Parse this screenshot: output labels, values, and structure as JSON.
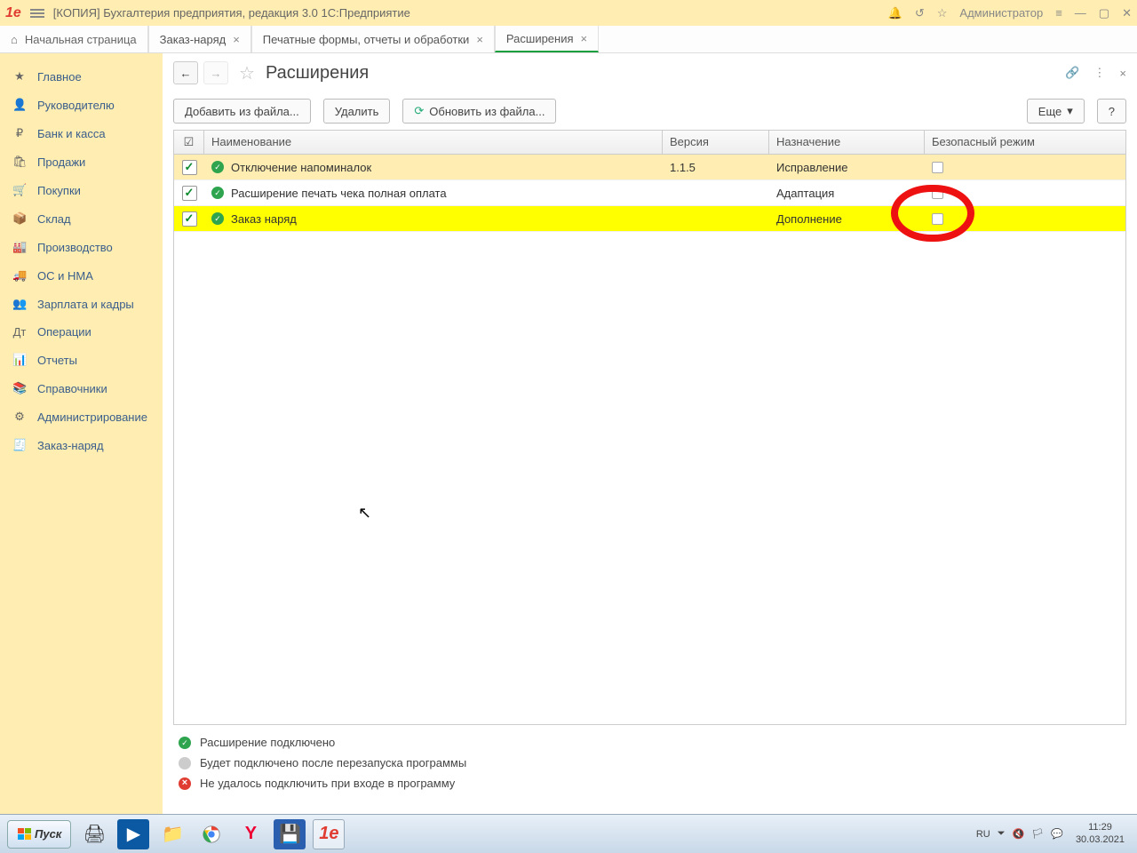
{
  "titlebar": {
    "title": "[КОПИЯ] Бухгалтерия предприятия, редакция 3.0 1С:Предприятие",
    "user": "Администратор"
  },
  "tabs": {
    "home": "Начальная страница",
    "items": [
      {
        "label": "Заказ-наряд",
        "closable": true
      },
      {
        "label": "Печатные формы, отчеты и обработки",
        "closable": true
      },
      {
        "label": "Расширения",
        "closable": true,
        "active": true
      }
    ]
  },
  "sidebar": {
    "items": [
      {
        "label": "Главное"
      },
      {
        "label": "Руководителю"
      },
      {
        "label": "Банк и касса"
      },
      {
        "label": "Продажи"
      },
      {
        "label": "Покупки"
      },
      {
        "label": "Склад"
      },
      {
        "label": "Производство"
      },
      {
        "label": "ОС и НМА"
      },
      {
        "label": "Зарплата и кадры"
      },
      {
        "label": "Операции"
      },
      {
        "label": "Отчеты"
      },
      {
        "label": "Справочники"
      },
      {
        "label": "Администрирование"
      },
      {
        "label": "Заказ-наряд"
      }
    ]
  },
  "page": {
    "title": "Расширения"
  },
  "toolbar": {
    "add": "Добавить из файла...",
    "del": "Удалить",
    "upd": "Обновить из файла...",
    "more": "Еще",
    "help": "?"
  },
  "table": {
    "columns": {
      "name": "Наименование",
      "version": "Версия",
      "purpose": "Назначение",
      "safe": "Безопасный режим"
    },
    "rows": [
      {
        "checked": true,
        "status": "ok",
        "name": "Отключение напоминалок",
        "version": "1.1.5",
        "purpose": "Исправление",
        "safe": false,
        "selected": true
      },
      {
        "checked": true,
        "status": "ok",
        "name": "Расширение печать чека полная оплата",
        "version": "",
        "purpose": "Адаптация",
        "safe": false
      },
      {
        "checked": true,
        "status": "ok",
        "name": "Заказ наряд",
        "version": "",
        "purpose": "Дополнение",
        "safe": false,
        "highlighted": true
      }
    ]
  },
  "legend": {
    "ok": "Расширение подключено",
    "pending": "Будет подключено после перезапуска программы",
    "fail": "Не удалось подключить при входе в программу"
  },
  "taskbar": {
    "start": "Пуск",
    "lang": "RU",
    "time": "11:29",
    "date": "30.03.2021"
  }
}
